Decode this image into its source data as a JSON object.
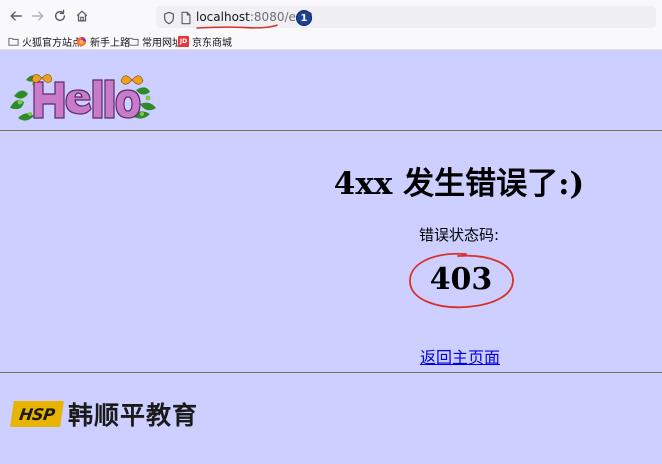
{
  "browser": {
    "url_host": "localhost",
    "url_rest": ":8080/err3",
    "annotation_badge": "1",
    "bookmarks": [
      {
        "label": "火狐官方站点",
        "icon": "folder-icon"
      },
      {
        "label": "新手上路",
        "icon": "firefox-icon"
      },
      {
        "label": "常用网址",
        "icon": "folder-icon"
      },
      {
        "label": "京东商城",
        "icon": "jd-icon",
        "icon_text": "JD"
      }
    ]
  },
  "page": {
    "logo_text": "Hello",
    "title": "4xx 发生错误了:)",
    "status_label": "错误状态码:",
    "status_code": "403",
    "home_link": "返回主页面",
    "brand_badge": "HSP",
    "brand_name": "韩顺平教育"
  },
  "colors": {
    "page_background": "#cccfff",
    "link": "#0000ee",
    "annotation_red": "#d8312a",
    "brand_yellow": "#e8b400"
  }
}
